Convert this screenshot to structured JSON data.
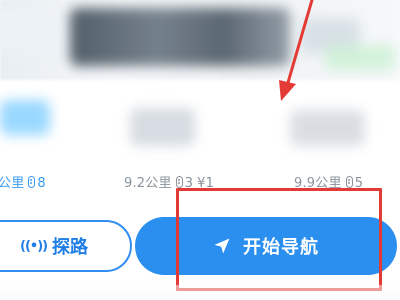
{
  "routes": [
    {
      "distance": "公里",
      "traffic_lights": "8",
      "toll": ""
    },
    {
      "distance": "9.2公里",
      "traffic_lights": "3",
      "toll": "¥1"
    },
    {
      "distance": "9.9公里",
      "traffic_lights": "5",
      "toll": ""
    }
  ],
  "buttons": {
    "explore_icon": "((•))",
    "explore_label": "探路",
    "start_nav_label": "开始导航"
  },
  "colors": {
    "accent": "#2b8ff0",
    "annotation": "#e43a35",
    "route_active": "#3a9cf2",
    "route_inactive": "#8a939b"
  },
  "icons": {
    "navigate": "navigate-arrow-icon",
    "explore": "broadcast-signal-icon",
    "traffic_light": "traffic-light-icon"
  }
}
